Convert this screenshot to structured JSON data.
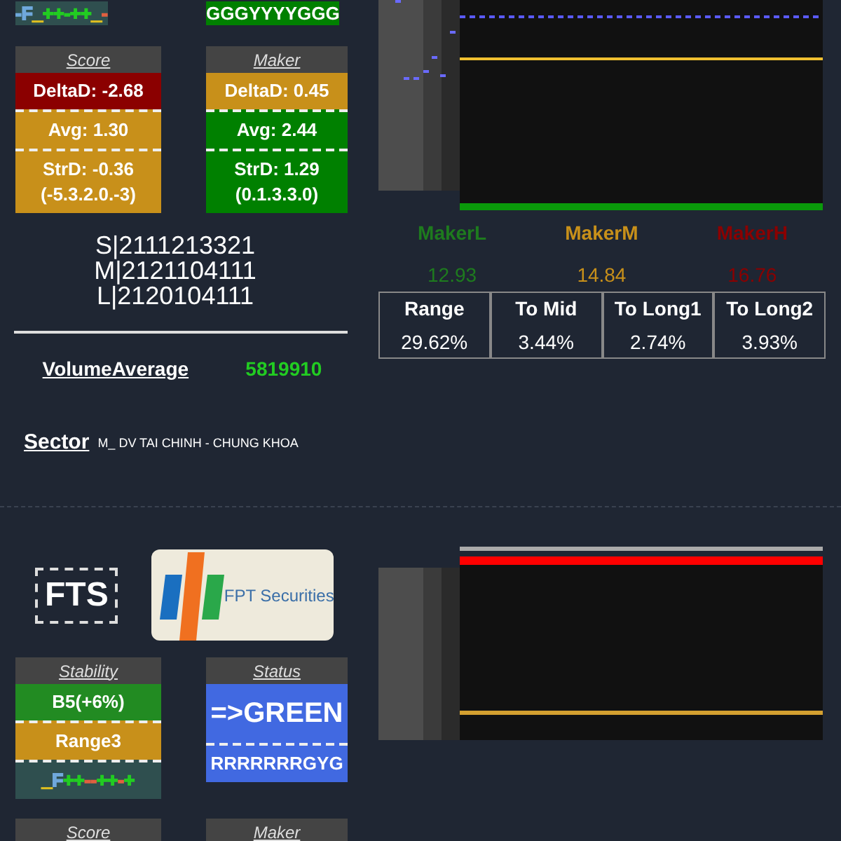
{
  "top": {
    "partial_cards": [
      {
        "rows": [
          {
            "kind": "segments",
            "color": "#2f4f4f",
            "segments": [
              {
                "text": "-F",
                "color": "#6fa8dc"
              },
              {
                "text": "_",
                "color": "#e0c020"
              },
              {
                "text": "++-++",
                "color": "#22cc22"
              },
              {
                "text": "_",
                "color": "#e0c020"
              },
              {
                "text": "-",
                "color": "#e06040"
              }
            ]
          }
        ]
      },
      {
        "rows": [
          {
            "kind": "text",
            "color": "#008000",
            "lines": [
              "GGGYYYYGGG"
            ]
          }
        ]
      }
    ],
    "cards": [
      {
        "title": "Score",
        "rows": [
          {
            "kind": "text",
            "color": "#8b0000",
            "lines": [
              "DeltaD: -2.68"
            ]
          },
          {
            "kind": "text",
            "color": "#c8901a",
            "lines": [
              "Avg: 1.30"
            ]
          },
          {
            "kind": "text",
            "color": "#c8901a",
            "lines": [
              "StrD: -0.36",
              "(-5.3.2.0.-3)"
            ]
          }
        ]
      },
      {
        "title": "Maker",
        "rows": [
          {
            "kind": "text",
            "color": "#c8901a",
            "lines": [
              "DeltaD: 0.45"
            ]
          },
          {
            "kind": "text",
            "color": "#008000",
            "lines": [
              "Avg: 2.44"
            ]
          },
          {
            "kind": "text",
            "color": "#008000",
            "lines": [
              "StrD: 1.29",
              "(0.1.3.3.0)"
            ]
          }
        ]
      }
    ],
    "codes": [
      "S|2111213321",
      "M|2121104111",
      "L|2120104111"
    ],
    "volume": {
      "label": "VolumeAverage",
      "value": "5819910"
    },
    "sector": {
      "label": "Sector",
      "value": "M_ DV TAI CHINH - CHUNG KHOA"
    },
    "makers": [
      {
        "label": "MakerL",
        "value": "12.93",
        "color": "#1e7b1e"
      },
      {
        "label": "MakerM",
        "value": "14.84",
        "color": "#c8901a"
      },
      {
        "label": "MakerH",
        "value": "16.76",
        "color": "#8b0000"
      }
    ],
    "ranges": [
      {
        "label": "Range",
        "value": "29.62%"
      },
      {
        "label": "To Mid",
        "value": "3.44%"
      },
      {
        "label": "To Long1",
        "value": "2.74%"
      },
      {
        "label": "To Long2",
        "value": "3.93%"
      }
    ]
  },
  "bottom": {
    "ticker": "FTS",
    "logo": {
      "text": "FPT Securities"
    },
    "cards": [
      {
        "title": "Stability",
        "rows": [
          {
            "kind": "text",
            "color": "#228b22",
            "lines": [
              "B5(+6%)"
            ]
          },
          {
            "kind": "text",
            "color": "#c8901a",
            "lines": [
              "Range3"
            ]
          },
          {
            "kind": "segments",
            "color": "#2f4f4f",
            "segments": [
              {
                "text": "_",
                "color": "#e0c020"
              },
              {
                "text": "F",
                "color": "#6fa8dc"
              },
              {
                "text": "++",
                "color": "#22cc22"
              },
              {
                "text": "--",
                "color": "#e06040"
              },
              {
                "text": "++",
                "color": "#22cc22"
              },
              {
                "text": "-",
                "color": "#e06040"
              },
              {
                "text": "+",
                "color": "#22cc22"
              }
            ]
          }
        ]
      },
      {
        "title": "Status",
        "rows": [
          {
            "kind": "large",
            "color": "#4169e1",
            "lines": [
              "=>GREEN"
            ]
          },
          {
            "kind": "text",
            "color": "#4169e1",
            "lines": [
              "RRRRRRRGYG"
            ]
          }
        ]
      }
    ],
    "partial_cards": [
      {
        "title": "Score"
      },
      {
        "title": "Maker"
      }
    ]
  }
}
